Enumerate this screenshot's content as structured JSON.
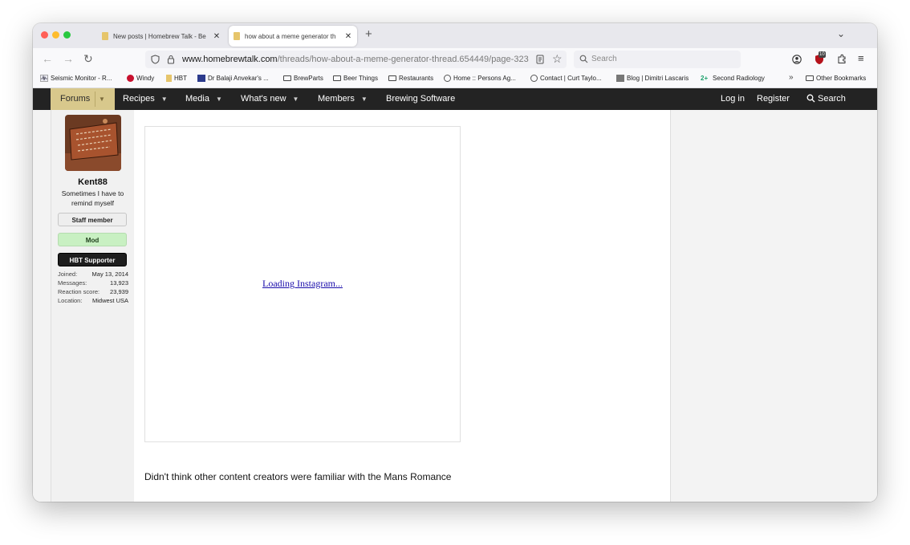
{
  "browser": {
    "tabs": [
      {
        "title": "New posts | Homebrew Talk - Be",
        "active": false
      },
      {
        "title": "how about a meme generator th",
        "active": true
      }
    ],
    "url_domain": "www.homebrewtalk.com",
    "url_path": "/threads/how-about-a-meme-generator-thread.654449/page-323",
    "search_placeholder": "Search",
    "extension_badge": "10",
    "bookmarks": [
      "Seismic Monitor - R...",
      "Windy",
      "HBT",
      "Dr Balaji Anvekar's ...",
      "BrewParts",
      "Beer Things",
      "Restaurants",
      "Home :: Persons Ag...",
      "Contact | Curt Taylo...",
      "Blog | Dimitri Lascaris",
      "Second Radiology"
    ],
    "other_bookmarks": "Other Bookmarks"
  },
  "site_nav": {
    "forums": "Forums",
    "recipes": "Recipes",
    "media": "Media",
    "whats_new": "What's new",
    "members": "Members",
    "brewing_software": "Brewing Software",
    "login": "Log in",
    "register": "Register",
    "search": "Search"
  },
  "user": {
    "name": "Kent88",
    "title": "Sometimes I have to remind myself",
    "badges": {
      "staff": "Staff member",
      "mod": "Mod",
      "supporter": "HBT Supporter"
    },
    "stats": [
      {
        "label": "Joined:",
        "value": "May 13, 2014"
      },
      {
        "label": "Messages:",
        "value": "13,923"
      },
      {
        "label": "Reaction score:",
        "value": "23,939"
      },
      {
        "label": "Location:",
        "value": "Midwest USA"
      }
    ]
  },
  "post": {
    "embed_link": "Loading Instagram...",
    "text": "Didn't think other content creators were familiar with the Mans Romance"
  },
  "colors": {
    "nav_bg": "#232323",
    "forums_tab": "#d8c88c",
    "mod_badge": "#c8f0c2",
    "link": "#1a0dab"
  }
}
